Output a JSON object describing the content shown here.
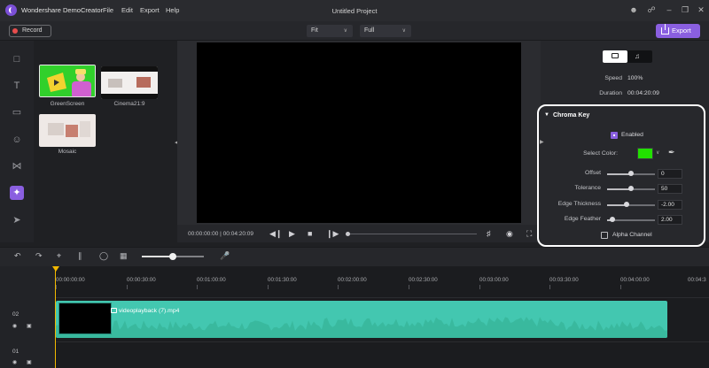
{
  "app": {
    "name": "Wondershare DemoCreator",
    "menu": [
      "File",
      "Edit",
      "Export",
      "Help"
    ],
    "project_title": "Untitled Project"
  },
  "toolbar": {
    "record_label": "Record",
    "fit_select": "Fit",
    "quality_select": "Full",
    "export_label": "Export"
  },
  "media": {
    "items": [
      {
        "label": "GreenScreen"
      },
      {
        "label": "Cinema21:9"
      },
      {
        "label": "Mosaic"
      }
    ]
  },
  "player": {
    "current_time": "00:00:00:00",
    "separator": "|",
    "total_time": "00:04:20:09"
  },
  "properties": {
    "speed_label": "Speed",
    "speed_value": "100%",
    "duration_label": "Duration",
    "duration_value": "00:04:20:09",
    "chroma": {
      "title": "Chroma Key",
      "enabled_label": "Enabled",
      "enabled": true,
      "select_color_label": "Select Color:",
      "color": "#22e000",
      "sliders": [
        {
          "label": "Offset",
          "value": "0",
          "level": 0.5
        },
        {
          "label": "Tolerance",
          "value": "50",
          "level": 0.5
        },
        {
          "label": "Edge Thickness",
          "value": "-2.00",
          "level": 0.4
        },
        {
          "label": "Edge Feather",
          "value": "2.00",
          "level": 0.1
        }
      ],
      "alpha_label": "Alpha Channel",
      "alpha": false
    }
  },
  "timeline": {
    "ruler": [
      "00:00:00:00",
      "00:00:30:00",
      "00:01:00:00",
      "00:01:30:00",
      "00:02:00:00",
      "00:02:30:00",
      "00:03:00:00",
      "00:03:30:00",
      "00:04:00:00",
      "00:04:3"
    ],
    "tracks": [
      {
        "number": "02"
      },
      {
        "number": "01"
      }
    ],
    "clip_name": "videoplayback (7).mp4",
    "zoom_level": 0.5
  },
  "colors": {
    "accent": "#8a5fe0",
    "clip": "#43c7b0",
    "playhead": "#f2b800"
  }
}
